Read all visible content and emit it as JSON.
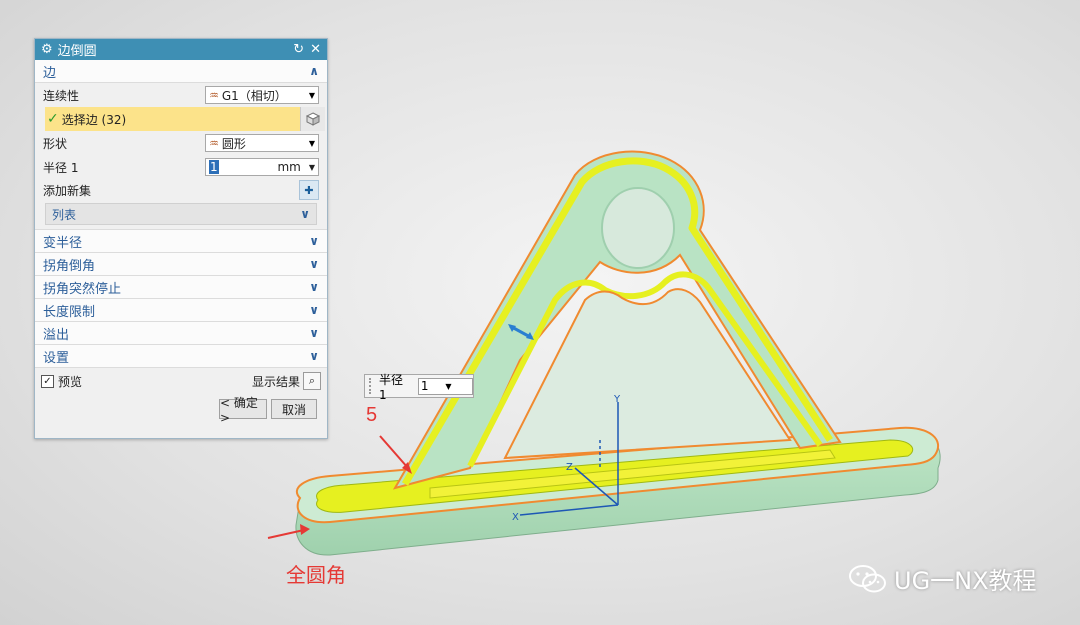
{
  "dialog": {
    "title": "边倒圆",
    "icons": [
      "gear-icon",
      "reset-icon",
      "close-icon"
    ],
    "edge_section": {
      "label": "边"
    },
    "continuity": {
      "label": "连续性",
      "value": "G1（相切）"
    },
    "select_edge": {
      "label": "选择边 (32)"
    },
    "shape": {
      "label": "形状",
      "value": "圆形"
    },
    "radius": {
      "label": "半径 1",
      "value": "1",
      "unit": "mm"
    },
    "add_set": {
      "label": "添加新集"
    },
    "list": {
      "label": "列表"
    },
    "collapsed_sections": [
      {
        "label": "变半径"
      },
      {
        "label": "拐角倒角"
      },
      {
        "label": "拐角突然停止"
      },
      {
        "label": "长度限制"
      },
      {
        "label": "溢出"
      },
      {
        "label": "设置"
      }
    ],
    "preview": {
      "label": "预览",
      "checked": true
    },
    "show_result": {
      "label": "显示结果"
    },
    "ok_button": "< 确定 >",
    "cancel_button": "取消"
  },
  "radius_popup": {
    "label": "半径 1",
    "value": "1"
  },
  "annotations": {
    "number": "5",
    "full_round": "全圆角",
    "color": "#e53935"
  },
  "axes": {
    "x": "X",
    "y": "Y",
    "z": "Z"
  },
  "watermark": {
    "text": "UG一NX教程",
    "icon": "wechat-icon"
  },
  "colors": {
    "fillet": "#e6f020",
    "solid": "#a6d8b4",
    "edge_highlight": "#f08a30",
    "title_bar": "#3e8fb4"
  }
}
